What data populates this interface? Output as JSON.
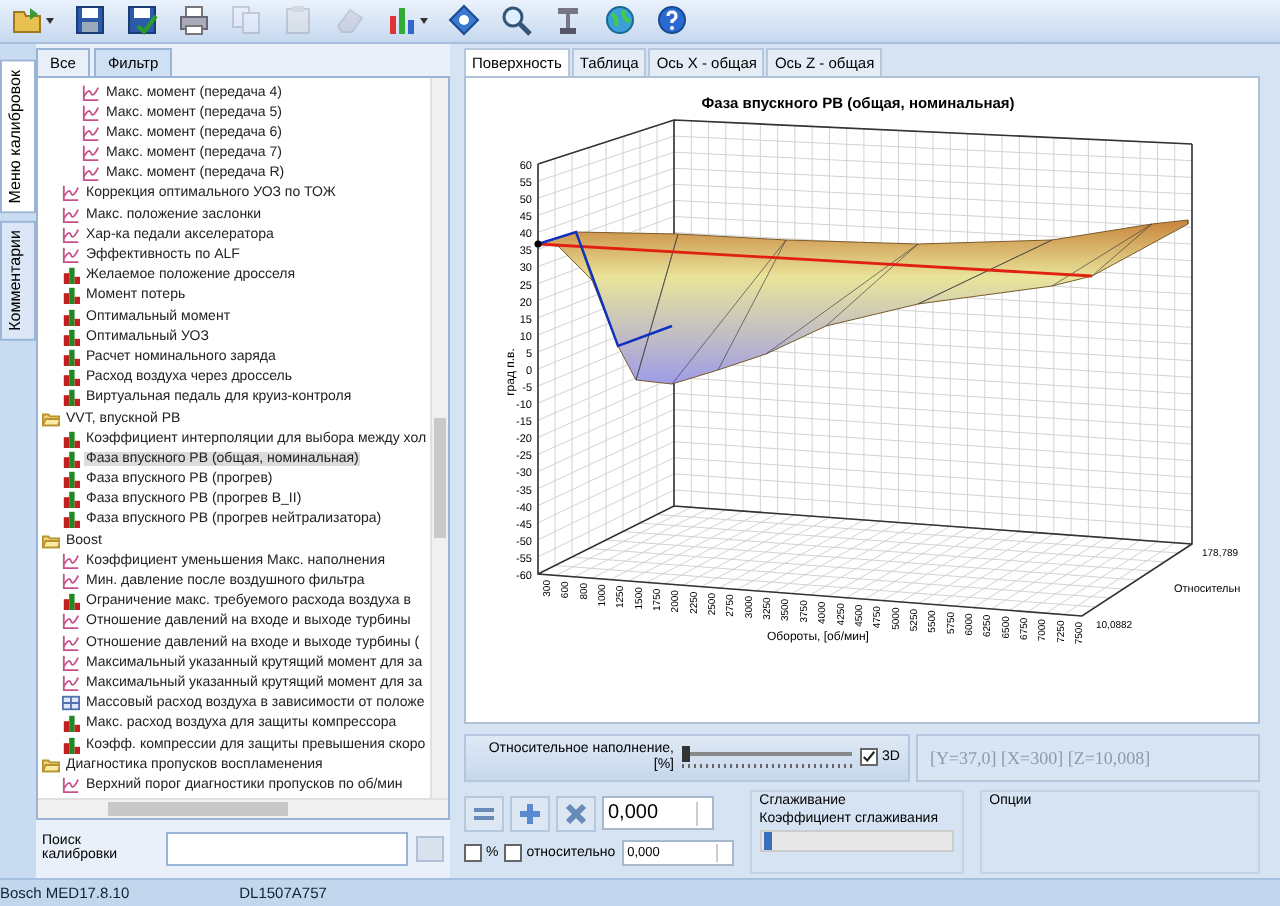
{
  "toolbar": {
    "buttons": [
      {
        "kind": "open",
        "disabled": false,
        "dropdown": true
      },
      {
        "kind": "save",
        "disabled": false,
        "dropdown": false
      },
      {
        "kind": "save-check",
        "disabled": false,
        "dropdown": false
      },
      {
        "kind": "print",
        "disabled": false,
        "dropdown": false
      },
      {
        "kind": "copy",
        "disabled": true,
        "dropdown": false
      },
      {
        "kind": "paste",
        "disabled": true,
        "dropdown": false
      },
      {
        "kind": "pages",
        "disabled": true,
        "dropdown": false
      },
      {
        "kind": "chart",
        "disabled": false,
        "dropdown": true
      },
      {
        "kind": "diamond",
        "disabled": false,
        "dropdown": false
      },
      {
        "kind": "zoom",
        "disabled": false,
        "dropdown": false
      },
      {
        "kind": "tool",
        "disabled": false,
        "dropdown": false
      },
      {
        "kind": "globe",
        "disabled": false,
        "dropdown": false
      },
      {
        "kind": "help",
        "disabled": false,
        "dropdown": false
      }
    ]
  },
  "side_tabs": [
    {
      "label": "Меню калибровок",
      "selected": true
    },
    {
      "label": "Комментарии",
      "selected": false
    }
  ],
  "tree_tabs": [
    {
      "label": "Все",
      "selected": false
    },
    {
      "label": "Фильтр",
      "selected": true
    }
  ],
  "tree": [
    {
      "kind": "branch",
      "children": [
        {
          "kind": "branch",
          "children": [
            {
              "kind": "curve",
              "label": "Макс. момент (передача 4)",
              "selected": false
            },
            {
              "kind": "curve",
              "label": "Макс. момент (передача 5)",
              "selected": false
            },
            {
              "kind": "curve",
              "label": "Макс. момент (передача 6)",
              "selected": false
            },
            {
              "kind": "curve",
              "label": "Макс. момент (передача 7)",
              "selected": false
            },
            {
              "kind": "curve",
              "label": "Макс. момент (передача R)",
              "selected": false
            }
          ]
        },
        {
          "kind": "curve",
          "label": "Коррекция оптимального УОЗ по ТОЖ",
          "selected": false
        },
        {
          "kind": "curve",
          "label": "Макс. положение заслонки",
          "selected": false
        },
        {
          "kind": "curve",
          "label": "Хар-ка педали акселератора",
          "selected": false
        },
        {
          "kind": "curve",
          "label": "Эффективность по ALF",
          "selected": false
        },
        {
          "kind": "map",
          "label": "Желаемое положение дросселя",
          "selected": false
        },
        {
          "kind": "map",
          "label": "Момент потерь",
          "selected": false
        },
        {
          "kind": "map",
          "label": "Оптимальный момент",
          "selected": false
        },
        {
          "kind": "map",
          "label": "Оптимальный УОЗ",
          "selected": false
        },
        {
          "kind": "map",
          "label": "Расчет номинального заряда",
          "selected": false
        },
        {
          "kind": "map",
          "label": "Расход воздуха через дроссель",
          "selected": false
        },
        {
          "kind": "map",
          "label": "Виртуальная педаль для круиз-контроля",
          "selected": false
        }
      ]
    },
    {
      "kind": "folder",
      "label": "VVT, впускной РВ",
      "expanded": true,
      "children": [
        {
          "kind": "map",
          "label": "Коэффициент интерполяции для выбора между хол",
          "selected": false
        },
        {
          "kind": "map",
          "label": "Фаза впускного РВ (общая, номинальная)",
          "selected": true
        },
        {
          "kind": "map",
          "label": "Фаза впускного РВ (прогрев)",
          "selected": false
        },
        {
          "kind": "map",
          "label": "Фаза впускного РВ (прогрев B_II)",
          "selected": false
        },
        {
          "kind": "map",
          "label": "Фаза впускного РВ (прогрев нейтрализатора)",
          "selected": false
        }
      ]
    },
    {
      "kind": "folder",
      "label": "Boost",
      "expanded": true,
      "children": [
        {
          "kind": "curve",
          "label": "Коэффициент уменьшения Макс. наполнения",
          "selected": false
        },
        {
          "kind": "curve",
          "label": "Мин. давление после воздушного фильтра",
          "selected": false
        },
        {
          "kind": "map",
          "label": "Ограничение макс. требуемого расхода воздуха в",
          "selected": false
        },
        {
          "kind": "curve",
          "label": "Отношение давлений на входе и выходе турбины",
          "selected": false
        },
        {
          "kind": "curve",
          "label": "Отношение давлений на входе и выходе турбины (",
          "selected": false
        },
        {
          "kind": "curve",
          "label": "Максимальный указанный крутящий момент для за",
          "selected": false
        },
        {
          "kind": "curve",
          "label": "Максимальный указанный крутящий момент для за",
          "selected": false
        },
        {
          "kind": "table",
          "label": "Массовый расход воздуха в зависимости от положе",
          "selected": false
        },
        {
          "kind": "map",
          "label": "Макс. расход воздуха для защиты компрессора",
          "selected": false
        },
        {
          "kind": "map",
          "label": "Коэфф. компрессии для защиты превышения скоро",
          "selected": false
        }
      ]
    },
    {
      "kind": "folder",
      "label": "Диагностика пропусков воспламенения",
      "expanded": true,
      "children": [
        {
          "kind": "curve",
          "label": "Верхний порог диагностики пропусков по об/мин",
          "selected": false
        }
      ]
    }
  ],
  "search": {
    "label": "Поиск калибровки"
  },
  "status_bar": {
    "items": [
      "Bosch MED17.8.10",
      "DL1507A757"
    ]
  },
  "view_tabs": [
    {
      "label": "Поверхность",
      "selected": true
    },
    {
      "label": "Таблица",
      "selected": false
    },
    {
      "label": "Ось X - общая",
      "selected": false
    },
    {
      "label": "Ось Z - общая",
      "selected": false
    }
  ],
  "chart": {
    "title": "Фаза впускного РВ (общая, номинальная)",
    "ylabel": "град п.в.",
    "xlabel": "Обороты, [об/мин]",
    "zlabel": "Относительн",
    "yticks": [
      "60",
      "55",
      "50",
      "45",
      "40",
      "35",
      "30",
      "25",
      "20",
      "15",
      "10",
      "5",
      "0",
      "-5",
      "-10",
      "-15",
      "-20",
      "-25",
      "-30",
      "-35",
      "-40",
      "-45",
      "-50",
      "-55",
      "-60"
    ],
    "xticks": [
      "300",
      "600",
      "800",
      "1000",
      "1250",
      "1500",
      "1750",
      "2000",
      "2250",
      "2500",
      "2750",
      "3000",
      "3250",
      "3500",
      "3750",
      "4000",
      "4250",
      "4500",
      "4750",
      "5000",
      "5250",
      "5500",
      "5750",
      "6000",
      "6250",
      "6500",
      "6750",
      "7000",
      "7250",
      "7500"
    ],
    "zticks": [
      "10,0882",
      "178,789"
    ]
  },
  "fill_panel": {
    "label": "Относительное наполнение, [%]",
    "level": 0,
    "checkbox": {
      "label": "3D",
      "checked": true
    },
    "readout": "[Y=37,0] [X=300] [Z=10,008]"
  },
  "edit_panel": {
    "value": "0,000",
    "step": "0,000",
    "percent": {
      "label": "%",
      "checked": false
    },
    "relative": {
      "label": "относительно",
      "checked": false
    },
    "smoothing": {
      "title": "Сглаживание",
      "label": "Коэффициент сглаживания",
      "level": 0.02
    },
    "options": {
      "title": "Опции"
    }
  }
}
